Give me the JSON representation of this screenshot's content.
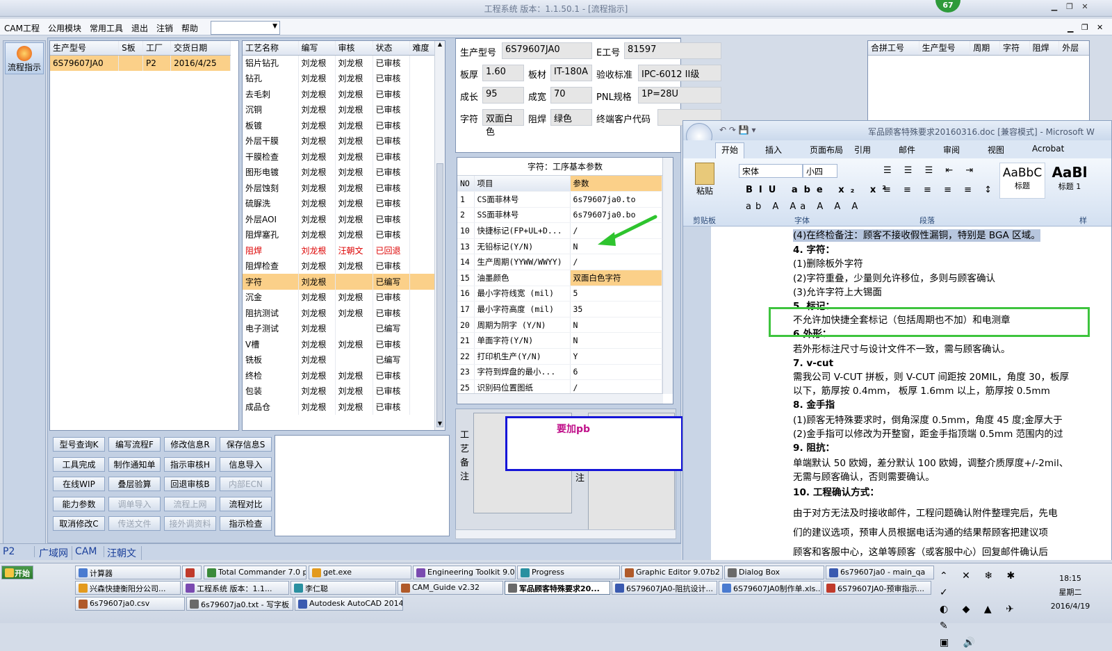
{
  "app": {
    "title": "工程系统  版本：1.1.50.1 - [流程指示]",
    "badge": "67"
  },
  "menu": [
    "CAM工程",
    "公用模块",
    "常用工具",
    "退出",
    "注销",
    "帮助"
  ],
  "flow_button": "流程指示",
  "orders": {
    "headers": [
      "生产型号",
      "S板",
      "工厂",
      "交货日期"
    ],
    "rows": [
      [
        "6S79607JA0",
        "",
        "P2",
        "2016/4/25"
      ]
    ]
  },
  "process": {
    "headers": [
      "工艺名称",
      "编写",
      "审核",
      "状态",
      "难度"
    ],
    "rows": [
      [
        "铝片钻孔",
        "刘龙根",
        "刘龙根",
        "已审核",
        ""
      ],
      [
        "钻孔",
        "刘龙根",
        "刘龙根",
        "已审核",
        ""
      ],
      [
        "去毛刺",
        "刘龙根",
        "刘龙根",
        "已审核",
        ""
      ],
      [
        "沉铜",
        "刘龙根",
        "刘龙根",
        "已审核",
        ""
      ],
      [
        "板镀",
        "刘龙根",
        "刘龙根",
        "已审核",
        ""
      ],
      [
        "外层干膜",
        "刘龙根",
        "刘龙根",
        "已审核",
        ""
      ],
      [
        "干膜检查",
        "刘龙根",
        "刘龙根",
        "已审核",
        ""
      ],
      [
        "图形电镀",
        "刘龙根",
        "刘龙根",
        "已审核",
        ""
      ],
      [
        "外层蚀刻",
        "刘龙根",
        "刘龙根",
        "已审核",
        ""
      ],
      [
        "硫脲洗",
        "刘龙根",
        "刘龙根",
        "已审核",
        ""
      ],
      [
        "外层AOI",
        "刘龙根",
        "刘龙根",
        "已审核",
        ""
      ],
      [
        "阻焊塞孔",
        "刘龙根",
        "刘龙根",
        "已审核",
        ""
      ],
      [
        "阻焊",
        "刘龙根",
        "汪朝文",
        "已回退",
        ""
      ],
      [
        "阻焊检查",
        "刘龙根",
        "刘龙根",
        "已审核",
        ""
      ],
      [
        "字符",
        "刘龙根",
        "",
        "已编写",
        ""
      ],
      [
        "沉金",
        "刘龙根",
        "刘龙根",
        "已审核",
        ""
      ],
      [
        "阻抗测试",
        "刘龙根",
        "刘龙根",
        "已审核",
        ""
      ],
      [
        "电子测试",
        "刘龙根",
        "",
        "已编写",
        ""
      ],
      [
        "V槽",
        "刘龙根",
        "刘龙根",
        "已审核",
        ""
      ],
      [
        "铣板",
        "刘龙根",
        "",
        "已编写",
        ""
      ],
      [
        "终检",
        "刘龙根",
        "刘龙根",
        "已审核",
        ""
      ],
      [
        "包装",
        "刘龙根",
        "刘龙根",
        "已审核",
        ""
      ],
      [
        "成品仓",
        "刘龙根",
        "刘龙根",
        "已审核",
        ""
      ]
    ]
  },
  "buttons": [
    [
      "型号查询K",
      "编写流程F",
      "修改信息R",
      "保存信息S"
    ],
    [
      "工具完成",
      "制作通知单",
      "指示审核H",
      "信息导入"
    ],
    [
      "在线WIP",
      "叠层验算",
      "回退审核B",
      "内部ECN"
    ],
    [
      "能力参数",
      "调单导入",
      "流程上网",
      "流程对比"
    ],
    [
      "取消修改C",
      "传送文件",
      "接外调资料",
      "指示检查"
    ]
  ],
  "disabled": [
    "内部ECN",
    "调单导入",
    "流程上网",
    "传送文件",
    "接外调资料"
  ],
  "info": {
    "生产型号": "6S79607JA0",
    "E工号": "81597",
    "板厚": "1.60",
    "板材": "IT-180A",
    "验收标准": "IPC-6012 II级",
    "成长": "95",
    "成宽": "70",
    "PNL规格": "1P=28U",
    "字符": "双面白色",
    "阻焊": "绿色",
    "终端客户代码": ""
  },
  "info_labels": [
    "生产型号",
    "E工号",
    "板厚",
    "板材",
    "验收标准",
    "成长",
    "成宽",
    "PNL规格",
    "字符",
    "阻焊",
    "终端客户代码"
  ],
  "merge_headers": [
    "合拼工号",
    "生产型号",
    "周期",
    "字符",
    "阻焊",
    "外层"
  ],
  "param_title": "字符：工序基本参数",
  "param_headers": [
    "NO",
    "项目",
    "参数"
  ],
  "params": [
    [
      "1",
      "CS面菲林号",
      "6s79607ja0.to"
    ],
    [
      "2",
      "SS面菲林号",
      "6s79607ja0.bo"
    ],
    [
      "10",
      "快捷标记(FP+UL+D...",
      "/"
    ],
    [
      "13",
      "无铅标记(Y/N)",
      "N"
    ],
    [
      "14",
      "生产周期(YYWW/WWYY)",
      "/"
    ],
    [
      "15",
      "油墨颜色",
      "双面白色字符"
    ],
    [
      "16",
      "最小字符线宽 (mil)",
      "5"
    ],
    [
      "17",
      "最小字符高度 (mil)",
      "35"
    ],
    [
      "20",
      "周期为阴字 (Y/N)",
      "N"
    ],
    [
      "21",
      "单面字符(Y/N)",
      "N"
    ],
    [
      "22",
      "打印机生产(Y/N)",
      "Y"
    ],
    [
      "23",
      "字符到焊盘的最小...",
      "6"
    ],
    [
      "25",
      "识别码位置图纸",
      "/"
    ]
  ],
  "remark_label": "工艺备注",
  "remark_label2": "注",
  "remark_note": "要加pb",
  "status_tabs": [
    "P2",
    "广域网",
    "CAM",
    "汪朝文"
  ],
  "word": {
    "title": "军品顾客特殊要求20160316.doc [兼容模式] - Microsoft W",
    "tabs": [
      "开始",
      "插入",
      "页面布局",
      "引用",
      "邮件",
      "审阅",
      "视图",
      "Acrobat"
    ],
    "font": "宋体",
    "size": "小四",
    "groups": [
      "剪贴板",
      "字体",
      "段落",
      "样"
    ],
    "paste": "粘贴",
    "styles": [
      "AaBbC",
      "AaBl"
    ],
    "style_names": [
      "标题",
      "标题 1"
    ],
    "lines": [
      "(4)在终检备注：顾客不接收假性漏铜，特别是 BGA 区域。",
      "4. 字符：",
      "(1)删除板外字符",
      "(2)字符重叠，少量则允许移位，多则与顾客确认",
      "(3)允许字符上大锡面",
      "5. 标记：",
      "不允许加快捷全套标记（包括周期也不加）和电测章",
      "6.外形：",
      "若外形标注尺寸与设计文件不一致，需与顾客确认。",
      "7. v-cut",
      "需我公司 V-CUT 拼板，则 V-CUT 间距按 20MIL，角度 30，板厚",
      "以下，筋厚按 0.4mm， 板厚 1.6mm 以上，筋厚按 0.5mm",
      "8. 金手指",
      "(1)顾客无特殊要求时，倒角深度 0.5mm，角度 45 度;金厚大于",
      "(2)金手指可以修改为开整窗，距金手指顶端 0.5mm 范围内的过",
      "9. 阻抗：",
      "单端默认 50 欧姆，差分默认 100 欧姆，调整介质厚度+/-2mil、",
      "无需与顾客确认，否则需要确认。",
      "10. 工程确认方式：",
      "由于对方无法及时接收邮件，工程问题确认附件整理完后，先电",
      "们的建议选项，预审人员根据电话沟通的结果帮顾客把建议项",
      "顾客和客服中心，这单等顾客（或客服中心）回复邮件确认后"
    ]
  },
  "taskbar": {
    "start": "开始",
    "time": "18:15",
    "day": "星期二",
    "date": "2016/4/19",
    "row1": [
      "计算器",
      "",
      "Total Commander 7.0 p...",
      "get.exe",
      "Engineering Toolkit 9.0...",
      "Progress",
      "Graphic Editor 9.07b2 (...",
      "Dialog Box",
      "6s79607ja0 - main_qa"
    ],
    "row2": [
      "兴森快捷衡阳分公司...",
      "工程系统  版本：1.1...",
      "李仁聪",
      "CAM_Guide v2.32",
      "军品顾客特殊要求20...",
      "6S79607JA0-阻抗设计...",
      "6S79607JA0制作单.xls...",
      "6S79607JA0-预审指示..."
    ],
    "row3": [
      "6s79607ja0.csv",
      "6s79607ja0.txt - 写字板",
      "Autodesk AutoCAD 2014..."
    ]
  }
}
